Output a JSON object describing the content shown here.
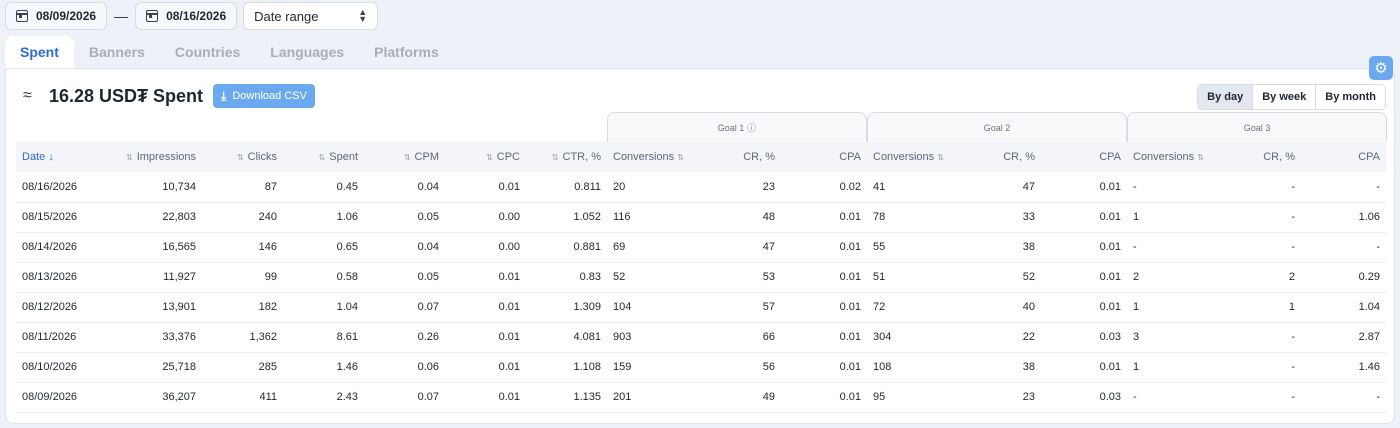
{
  "date_from": "08/09/2026",
  "date_to": "08/16/2026",
  "date_separator": "—",
  "range_select": "Date range",
  "tabs": [
    "Spent",
    "Banners",
    "Countries",
    "Languages",
    "Platforms"
  ],
  "total": "16.28 USD₮ Spent",
  "download_label": "Download CSV",
  "period_buttons": [
    "By day",
    "By week",
    "By month"
  ],
  "goals": [
    "Goal 1",
    "Goal 2",
    "Goal 3"
  ],
  "columns": [
    "Date",
    "Impressions",
    "Clicks",
    "Spent",
    "CPM",
    "CPC",
    "CTR, %",
    "Conversions",
    "CR, %",
    "CPA",
    "Conversions",
    "CR, %",
    "CPA",
    "Conversions",
    "CR, %",
    "CPA"
  ],
  "rows": [
    [
      "08/16/2026",
      "10,734",
      "87",
      "0.45",
      "0.04",
      "0.01",
      "0.811",
      "20",
      "23",
      "0.02",
      "41",
      "47",
      "0.01",
      "-",
      "-",
      "-"
    ],
    [
      "08/15/2026",
      "22,803",
      "240",
      "1.06",
      "0.05",
      "0.00",
      "1.052",
      "116",
      "48",
      "0.01",
      "78",
      "33",
      "0.01",
      "1",
      "-",
      "1.06"
    ],
    [
      "08/14/2026",
      "16,565",
      "146",
      "0.65",
      "0.04",
      "0.00",
      "0.881",
      "69",
      "47",
      "0.01",
      "55",
      "38",
      "0.01",
      "-",
      "-",
      "-"
    ],
    [
      "08/13/2026",
      "11,927",
      "99",
      "0.58",
      "0.05",
      "0.01",
      "0.83",
      "52",
      "53",
      "0.01",
      "51",
      "52",
      "0.01",
      "2",
      "2",
      "0.29"
    ],
    [
      "08/12/2026",
      "13,901",
      "182",
      "1.04",
      "0.07",
      "0.01",
      "1.309",
      "104",
      "57",
      "0.01",
      "72",
      "40",
      "0.01",
      "1",
      "1",
      "1.04"
    ],
    [
      "08/11/2026",
      "33,376",
      "1,362",
      "8.61",
      "0.26",
      "0.01",
      "4.081",
      "903",
      "66",
      "0.01",
      "304",
      "22",
      "0.03",
      "3",
      "-",
      "2.87"
    ],
    [
      "08/10/2026",
      "25,718",
      "285",
      "1.46",
      "0.06",
      "0.01",
      "1.108",
      "159",
      "56",
      "0.01",
      "108",
      "38",
      "0.01",
      "1",
      "-",
      "1.46"
    ],
    [
      "08/09/2026",
      "36,207",
      "411",
      "2.43",
      "0.07",
      "0.01",
      "1.135",
      "201",
      "49",
      "0.01",
      "95",
      "23",
      "0.03",
      "-",
      "-",
      "-"
    ]
  ]
}
